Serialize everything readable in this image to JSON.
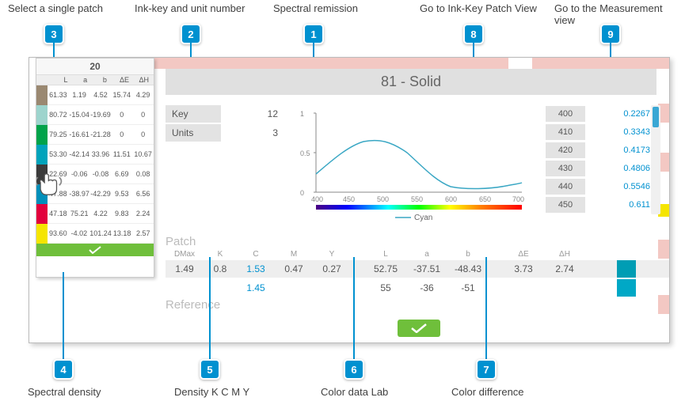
{
  "callouts": {
    "c1": {
      "num": "1",
      "label": "Spectral remission"
    },
    "c2": {
      "num": "2",
      "label": "Ink-key and unit number"
    },
    "c3": {
      "num": "3",
      "label": "Select a single patch"
    },
    "c4": {
      "num": "4",
      "label": "Spectral density"
    },
    "c5": {
      "num": "5",
      "label": "Density K C M Y"
    },
    "c6": {
      "num": "6",
      "label": "Color data Lab"
    },
    "c7": {
      "num": "7",
      "label": "Color difference"
    },
    "c8": {
      "num": "8",
      "label": "Go to Ink-Key Patch View"
    },
    "c9": {
      "num": "9",
      "label": "Go to the Measurement view"
    }
  },
  "sidebar": {
    "title": "20",
    "headers": {
      "l": "L",
      "a": "a",
      "b": "b",
      "de": "ΔE",
      "dh": "ΔH"
    },
    "rows": [
      {
        "sw": "#9a8871",
        "l": "61.33",
        "a": "1.19",
        "b": "4.52",
        "de": "15.74",
        "dh": "4.29"
      },
      {
        "sw": "#9dd4cd",
        "l": "80.72",
        "a": "-15.04",
        "b": "-19.69",
        "de": "0",
        "dh": "0"
      },
      {
        "sw": "#00a34a",
        "l": "79.25",
        "a": "-16.61",
        "b": "-21.28",
        "de": "0",
        "dh": "0"
      },
      {
        "sw": "#00a3bb",
        "l": "53.30",
        "a": "-42.14",
        "b": "33.96",
        "de": "11.51",
        "dh": "10.67"
      },
      {
        "sw": "#3b3b3b",
        "l": "22.69",
        "a": "-0.06",
        "b": "-0.08",
        "de": "6.69",
        "dh": "0.08"
      },
      {
        "sw": "#008fba",
        "l": "47.88",
        "a": "-38.97",
        "b": "-42.29",
        "de": "9.53",
        "dh": "6.56"
      },
      {
        "sw": "#e2003c",
        "l": "47.18",
        "a": "75.21",
        "b": "4.22",
        "de": "9.83",
        "dh": "2.24"
      },
      {
        "sw": "#f5e500",
        "l": "93.60",
        "a": "-4.02",
        "b": "101.24",
        "de": "13.18",
        "dh": "2.57"
      }
    ],
    "confirm": "✓"
  },
  "main": {
    "title": "81 - Solid",
    "info": {
      "key_label": "Key",
      "key_val": "12",
      "units_label": "Units",
      "units_val": "3"
    },
    "chart": {
      "ylabels": {
        "y1": "1",
        "y05": "0.5",
        "y0": "0"
      },
      "xlabels": {
        "x400": "400",
        "x450": "450",
        "x500": "500",
        "x550": "550",
        "x600": "600",
        "x650": "650",
        "x700": "700"
      },
      "legend": "Cyan"
    },
    "spectral": [
      {
        "wv": "400",
        "val": "0.2267"
      },
      {
        "wv": "410",
        "val": "0.3343"
      },
      {
        "wv": "420",
        "val": "0.4173"
      },
      {
        "wv": "430",
        "val": "0.4806"
      },
      {
        "wv": "440",
        "val": "0.5546"
      },
      {
        "wv": "450",
        "val": "0.611"
      }
    ],
    "patch": {
      "label_patch": "Patch",
      "label_ref": "Reference",
      "headers": {
        "dmax": "DMax",
        "k": "K",
        "c": "C",
        "m": "M",
        "y": "Y",
        "l": "L",
        "a": "a",
        "b": "b",
        "de": "ΔE",
        "dh": "ΔH"
      },
      "row": {
        "dmax": "1.49",
        "k": "0.8",
        "c": "1.53",
        "m": "0.47",
        "y": "0.27",
        "l": "52.75",
        "a": "-37.51",
        "b": "-48.43",
        "de": "3.73",
        "dh": "2.74"
      },
      "ref": {
        "c": "1.45",
        "l": "55",
        "a": "-36",
        "b": "-51"
      },
      "swatches": {
        "s1": "#009db4",
        "s2": "#00a8c6"
      },
      "confirm": "✓"
    }
  },
  "chart_data": {
    "type": "line",
    "title": "",
    "xlabel": "",
    "ylabel": "",
    "xlim": [
      400,
      700
    ],
    "ylim": [
      0,
      1
    ],
    "series": [
      {
        "name": "Cyan",
        "x": [
          400,
          410,
          420,
          430,
          440,
          450,
          460,
          470,
          480,
          490,
          500,
          510,
          520,
          530,
          540,
          550,
          560,
          570,
          580,
          590,
          600,
          610,
          620,
          630,
          640,
          650,
          660,
          670,
          680,
          690,
          700
        ],
        "y": [
          0.23,
          0.33,
          0.42,
          0.48,
          0.55,
          0.61,
          0.64,
          0.65,
          0.64,
          0.62,
          0.57,
          0.5,
          0.42,
          0.33,
          0.25,
          0.18,
          0.12,
          0.08,
          0.06,
          0.05,
          0.04,
          0.04,
          0.04,
          0.05,
          0.06,
          0.07,
          0.08,
          0.09,
          0.1,
          0.11,
          0.12
        ]
      }
    ]
  }
}
